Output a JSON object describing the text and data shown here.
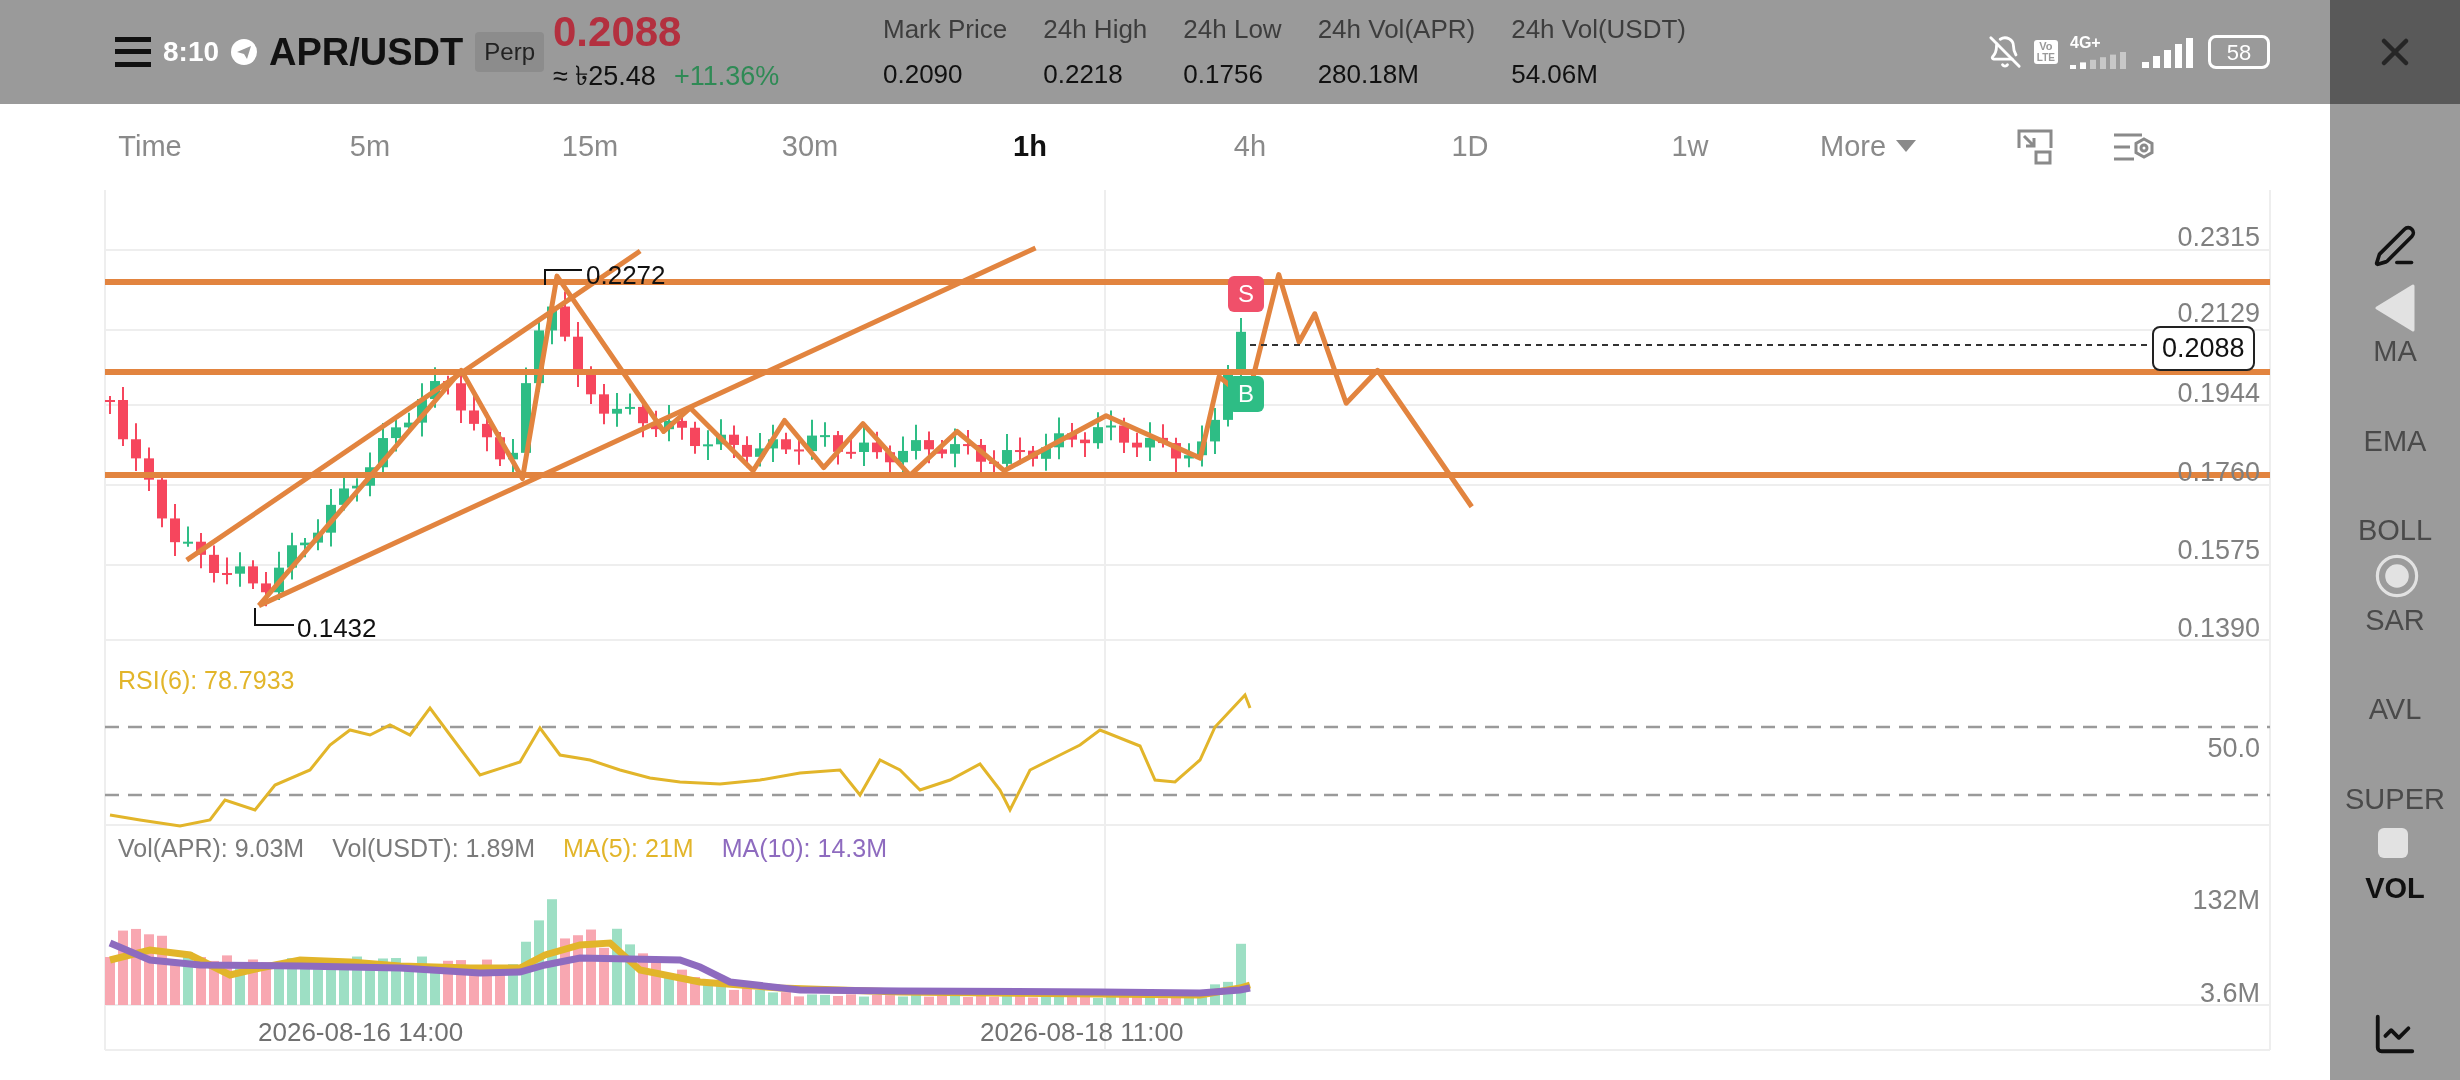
{
  "status_bar": {
    "time": "8:10",
    "volte": [
      "Vo",
      "LTE"
    ],
    "network": "4G+",
    "battery": "58"
  },
  "header": {
    "pair": "APR/USDT",
    "badge": "Perp",
    "last_price": "0.2088",
    "fiat_price": "≈ ৳25.48",
    "change": "+11.36%",
    "stats": [
      {
        "label": "Mark Price",
        "value": "0.2090"
      },
      {
        "label": "24h High",
        "value": "0.2218"
      },
      {
        "label": "24h Low",
        "value": "0.1756"
      },
      {
        "label": "24h Vol(APR)",
        "value": "280.18M"
      },
      {
        "label": "24h Vol(USDT)",
        "value": "54.06M"
      }
    ]
  },
  "intervals": [
    {
      "label": "Time",
      "selected": false
    },
    {
      "label": "5m",
      "selected": false
    },
    {
      "label": "15m",
      "selected": false
    },
    {
      "label": "30m",
      "selected": false
    },
    {
      "label": "1h",
      "selected": true
    },
    {
      "label": "4h",
      "selected": false
    },
    {
      "label": "1D",
      "selected": false
    },
    {
      "label": "1w",
      "selected": false
    }
  ],
  "more": {
    "label": "More"
  },
  "price_chart": {
    "price_ticks": [
      "0.2315",
      "0.2129",
      "0.1944",
      "0.1760",
      "0.1575",
      "0.1390"
    ],
    "high_label": "0.2272",
    "low_label": "0.1432",
    "current_price": "0.2088",
    "sell_marker": "S",
    "buy_marker": "B"
  },
  "rsi": {
    "label": "RSI(6): 78.7933",
    "level_label": "50.0"
  },
  "volume": {
    "legend": [
      {
        "text": "Vol(APR): 9.03M",
        "color": "#7a7a7a"
      },
      {
        "text": "Vol(USDT): 1.89M",
        "color": "#7a7a7a"
      },
      {
        "text": "MA(5): 21M",
        "color": "#e2b52a"
      },
      {
        "text": "MA(10): 14.3M",
        "color": "#8e6bbf"
      }
    ],
    "ticks": [
      "132M",
      "3.6M"
    ]
  },
  "time_axis": [
    "2026-08-16 14:00",
    "2026-08-18 11:00"
  ],
  "indicators": [
    {
      "label": "MA",
      "selected": false
    },
    {
      "label": "EMA",
      "selected": false
    },
    {
      "label": "BOLL",
      "selected": false
    },
    {
      "label": "SAR",
      "selected": false
    },
    {
      "label": "AVL",
      "selected": false
    },
    {
      "label": "SUPER",
      "selected": false
    },
    {
      "label": "VOL",
      "selected": true
    }
  ]
}
